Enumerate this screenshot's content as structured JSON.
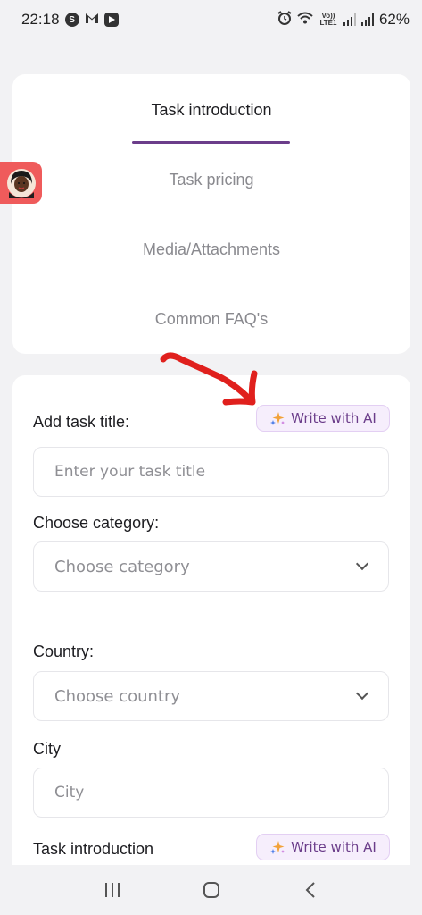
{
  "status_bar": {
    "time": "22:18",
    "battery": "62%",
    "network_label": "Vo)) LTE1"
  },
  "tabs": [
    {
      "label": "Task introduction",
      "active": true
    },
    {
      "label": "Task pricing",
      "active": false
    },
    {
      "label": "Media/Attachments",
      "active": false
    },
    {
      "label": "Common FAQ's",
      "active": false
    }
  ],
  "form": {
    "title_label": "Add task title:",
    "title_placeholder": "Enter your task title",
    "write_ai_label": "Write with AI",
    "category_label": "Choose category:",
    "category_value": "Choose category",
    "country_label": "Country:",
    "country_value": "Choose country",
    "city_label": "City",
    "city_placeholder": "City",
    "intro_label": "Task introduction",
    "write_ai_label_2": "Write with AI"
  },
  "colors": {
    "accent": "#6b3d8a",
    "ai_bg": "#f6eefc",
    "avatar_bg": "#ef5b5b",
    "annotation": "#e0201d"
  },
  "icons": [
    "s-icon",
    "gmail-icon",
    "youtube-icon",
    "alarm-icon",
    "wifi-icon",
    "signal-icon",
    "sparkle-icon",
    "chevron-down-icon",
    "recents-icon",
    "home-icon",
    "back-icon"
  ]
}
